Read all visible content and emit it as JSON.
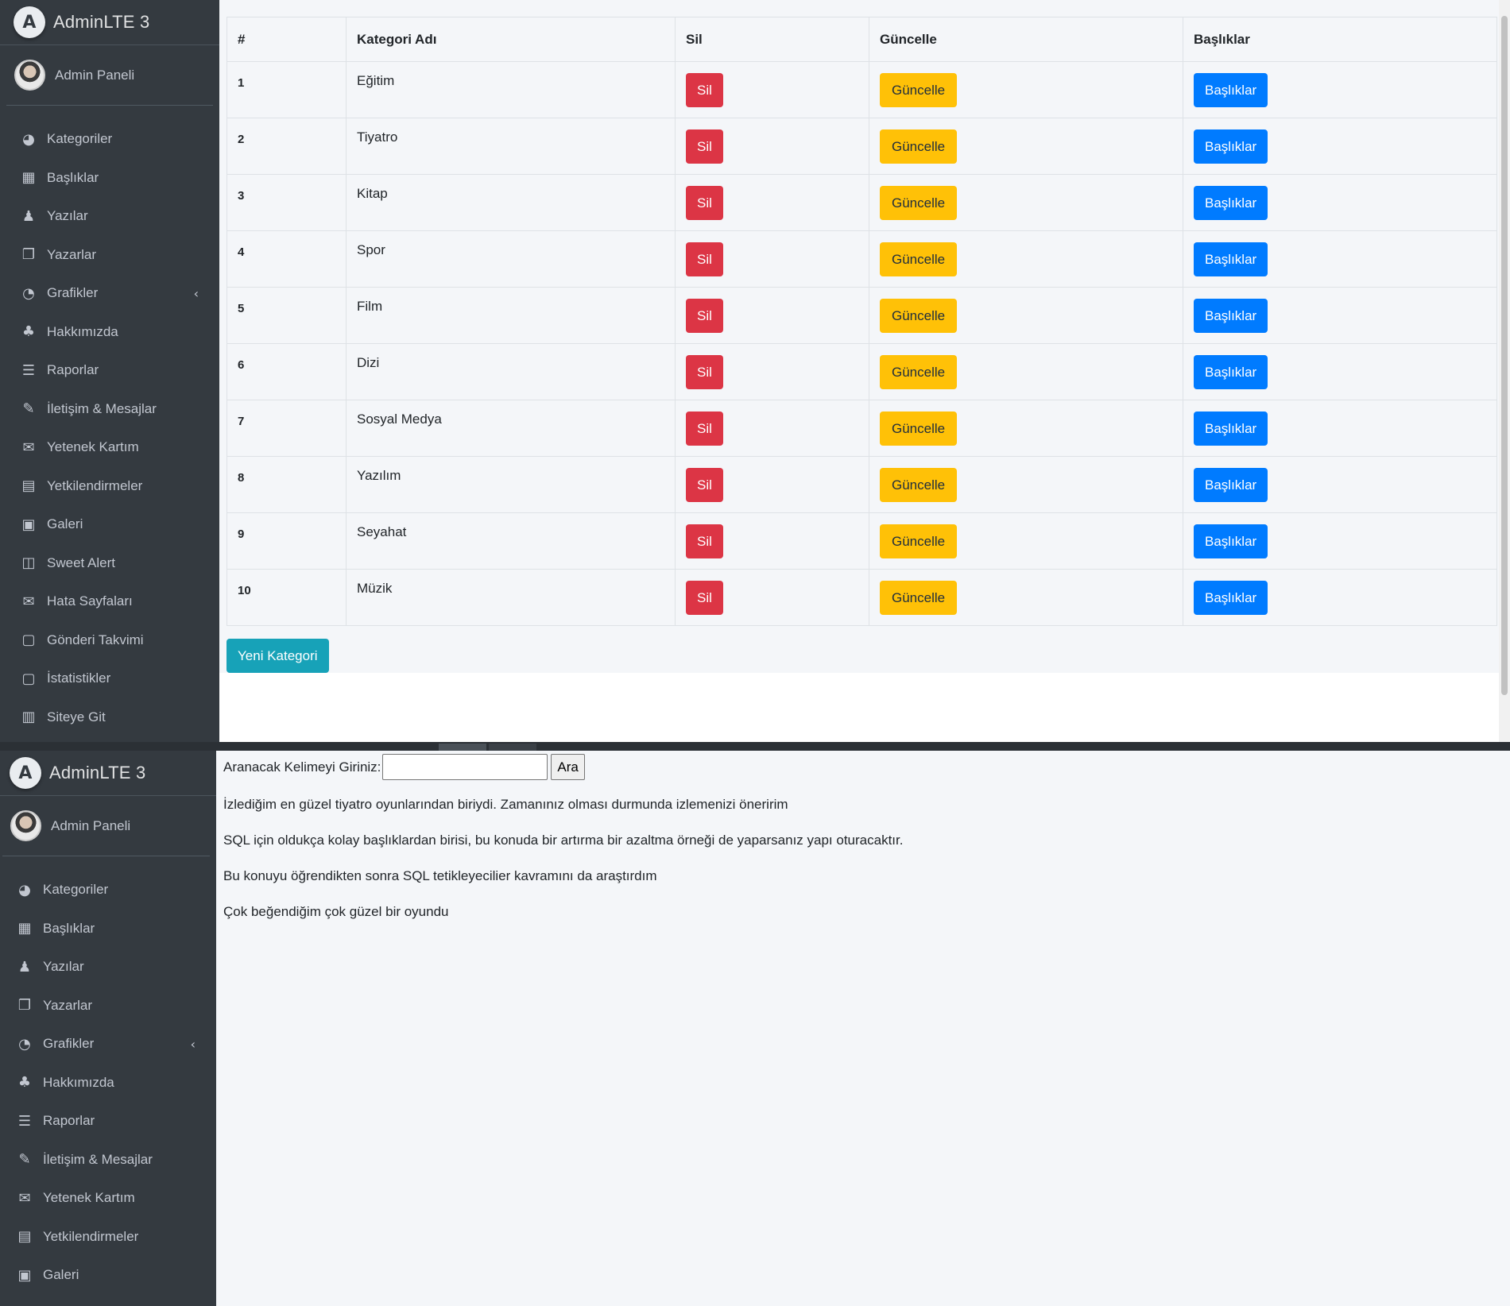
{
  "brand": "AdminLTE 3",
  "user": "Admin Paneli",
  "nav_top": [
    {
      "label": "Kategoriler",
      "icon": "dashboard-icon",
      "glyph": "◕"
    },
    {
      "label": "Başlıklar",
      "icon": "grid-icon",
      "glyph": "▦"
    },
    {
      "label": "Yazılar",
      "icon": "users-icon",
      "glyph": "♟"
    },
    {
      "label": "Yazarlar",
      "icon": "copy-icon",
      "glyph": "❐"
    },
    {
      "label": "Grafikler",
      "icon": "pie-chart-icon",
      "glyph": "◔"
    },
    {
      "label": "Hakkımızda",
      "icon": "tree-icon",
      "glyph": "♣"
    },
    {
      "label": "Raporlar",
      "icon": "bars-icon",
      "glyph": "☰"
    },
    {
      "label": "İletişim & Mesajlar",
      "icon": "edit-icon",
      "glyph": "✎"
    },
    {
      "label": "Yetenek Kartım",
      "icon": "envelope-icon",
      "glyph": "✉"
    },
    {
      "label": "Yetkilendirmeler",
      "icon": "calendar-icon",
      "glyph": "▤"
    },
    {
      "label": "Galeri",
      "icon": "image-icon",
      "glyph": "▣"
    },
    {
      "label": "Sweet Alert",
      "icon": "map-icon",
      "glyph": "◫"
    },
    {
      "label": "Hata Sayfaları",
      "icon": "envelope-icon",
      "glyph": "✉"
    },
    {
      "label": "Gönderi Takvimi",
      "icon": "calendar-icon",
      "glyph": "▢"
    },
    {
      "label": "İstatistikler",
      "icon": "calendar-icon",
      "glyph": "▢"
    },
    {
      "label": "Siteye Git",
      "icon": "book-icon",
      "glyph": "▥"
    }
  ],
  "nav_bottom": [
    {
      "label": "Kategoriler",
      "icon": "dashboard-icon",
      "glyph": "◕"
    },
    {
      "label": "Başlıklar",
      "icon": "grid-icon",
      "glyph": "▦"
    },
    {
      "label": "Yazılar",
      "icon": "users-icon",
      "glyph": "♟"
    },
    {
      "label": "Yazarlar",
      "icon": "copy-icon",
      "glyph": "❐"
    },
    {
      "label": "Grafikler",
      "icon": "pie-chart-icon",
      "glyph": "◔"
    },
    {
      "label": "Hakkımızda",
      "icon": "tree-icon",
      "glyph": "♣"
    },
    {
      "label": "Raporlar",
      "icon": "bars-icon",
      "glyph": "☰"
    },
    {
      "label": "İletişim & Mesajlar",
      "icon": "edit-icon",
      "glyph": "✎"
    },
    {
      "label": "Yetenek Kartım",
      "icon": "envelope-icon",
      "glyph": "✉"
    },
    {
      "label": "Yetkilendirmeler",
      "icon": "calendar-icon",
      "glyph": "▤"
    },
    {
      "label": "Galeri",
      "icon": "image-icon",
      "glyph": "▣"
    }
  ],
  "chevron": "‹",
  "table": {
    "headers": [
      "#",
      "Kategori Adı",
      "Sil",
      "Güncelle",
      "Başlıklar"
    ],
    "rows": [
      {
        "id": "1",
        "name": "Eğitim"
      },
      {
        "id": "2",
        "name": "Tiyatro"
      },
      {
        "id": "3",
        "name": "Kitap"
      },
      {
        "id": "4",
        "name": "Spor"
      },
      {
        "id": "5",
        "name": "Film"
      },
      {
        "id": "6",
        "name": "Dizi"
      },
      {
        "id": "7",
        "name": "Sosyal Medya"
      },
      {
        "id": "8",
        "name": "Yazılım"
      },
      {
        "id": "9",
        "name": "Seyahat"
      },
      {
        "id": "10",
        "name": "Müzik"
      }
    ],
    "delete_label": "Sil",
    "update_label": "Güncelle",
    "titles_label": "Başlıklar"
  },
  "new_category_label": "Yeni Kategori",
  "search": {
    "label": "Aranacak Kelimeyi Giriniz:",
    "value": "",
    "button": "Ara"
  },
  "posts": [
    "İzlediğim en güzel tiyatro oyunlarından biriydi. Zamanınız olması durmunda izlemenizi öneririm",
    "SQL için oldukça kolay başlıklardan birisi, bu konuda bir artırma bir azaltma örneği de yaparsanız yapı oturacaktır.",
    "Bu konuyu öğrendikten sonra SQL tetikleyecilier kavramını da araştırdım",
    "Çok beğendiğim çok güzel bir oyundu"
  ],
  "colors": {
    "sidebar": "#343a40",
    "danger": "#dc3545",
    "warning": "#ffc107",
    "primary": "#007bff",
    "info": "#17a2b8"
  }
}
